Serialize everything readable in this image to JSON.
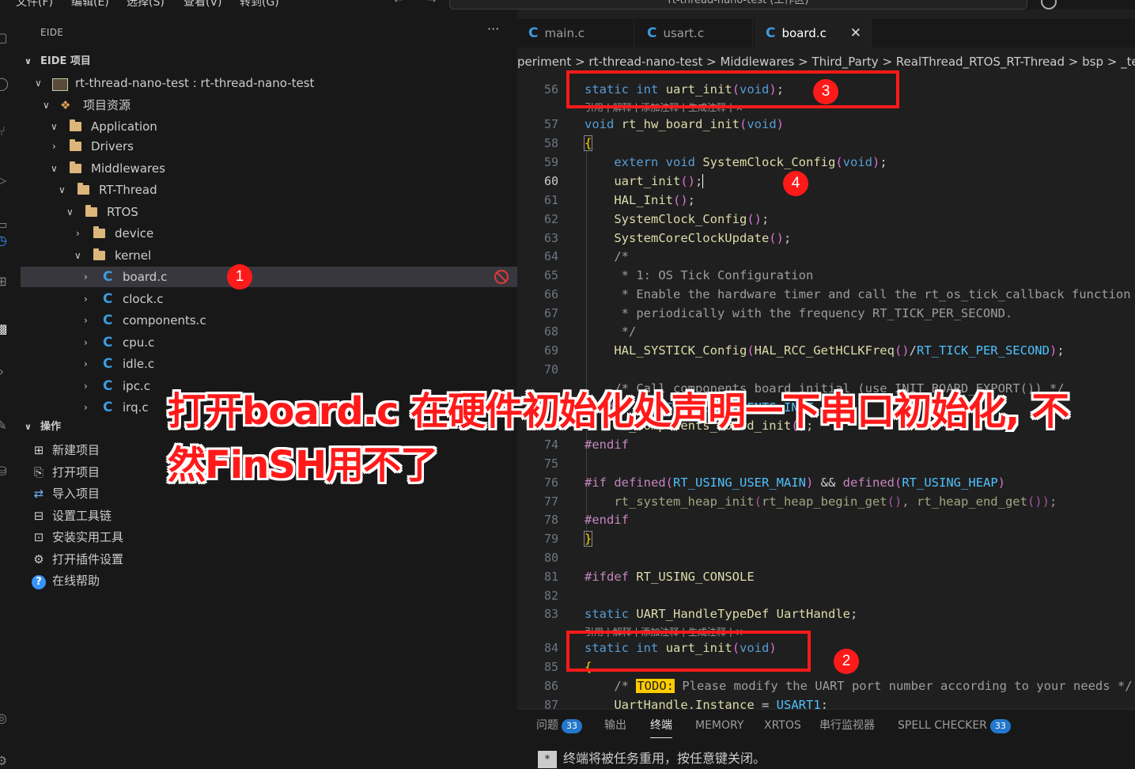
{
  "menu": [
    "文件(F)",
    "编辑(E)",
    "选择(S)",
    "查看(V)",
    "转到(G)"
  ],
  "command_center": "rt-thread-nano-test (工作区)",
  "sidebar": {
    "title": "EIDE",
    "section_project": "EIDE 项目",
    "tree": [
      {
        "label": "rt-thread-nano-test : rt-thread-nano-test"
      },
      {
        "label": "项目资源"
      },
      {
        "label": "Application"
      },
      {
        "label": "Drivers"
      },
      {
        "label": "Middlewares"
      },
      {
        "label": "RT-Thread"
      },
      {
        "label": "RTOS"
      },
      {
        "label": "device"
      },
      {
        "label": "kernel"
      },
      {
        "label": "board.c"
      },
      {
        "label": "clock.c"
      },
      {
        "label": "components.c"
      },
      {
        "label": "cpu.c"
      },
      {
        "label": "idle.c"
      },
      {
        "label": "ipc.c"
      },
      {
        "label": "irq.c"
      }
    ],
    "section_ops": "操作",
    "ops": [
      "新建项目",
      "打开项目",
      "导入项目",
      "设置工具链",
      "安装实用工具",
      "打开插件设置",
      "在线帮助"
    ]
  },
  "editor": {
    "tabs": [
      {
        "label": "main.c",
        "icon": "C"
      },
      {
        "label": "usart.c",
        "icon": "C"
      },
      {
        "label": "board.c",
        "icon": "C",
        "close": "✕"
      }
    ],
    "breadcrumb": "periment > rt-thread-nano-test > Middlewares > Third_Party > RealThread_RTOS_RT-Thread > bsp > _template",
    "codelens": "引用 | 解释 | 添加注释 | 生成注释 | ×",
    "lines": [
      {
        "n": "56"
      },
      {
        "n": "57"
      },
      {
        "n": "58"
      },
      {
        "n": "59"
      },
      {
        "n": "60"
      },
      {
        "n": "61"
      },
      {
        "n": "62"
      },
      {
        "n": "63"
      },
      {
        "n": "64"
      },
      {
        "n": "65"
      },
      {
        "n": "66"
      },
      {
        "n": "67"
      },
      {
        "n": "68"
      },
      {
        "n": "69"
      },
      {
        "n": "70"
      },
      {
        "n": "73"
      },
      {
        "n": "74"
      },
      {
        "n": "75"
      },
      {
        "n": "76"
      },
      {
        "n": "77"
      },
      {
        "n": "78"
      },
      {
        "n": "79"
      },
      {
        "n": "80"
      },
      {
        "n": "81"
      },
      {
        "n": "82"
      },
      {
        "n": "83"
      },
      {
        "n": "84"
      },
      {
        "n": "85"
      },
      {
        "n": "86"
      },
      {
        "n": "87"
      }
    ]
  },
  "panel": {
    "tabs": [
      {
        "label": "问题",
        "badge": "33"
      },
      {
        "label": "输出"
      },
      {
        "label": "终端"
      },
      {
        "label": "MEMORY"
      },
      {
        "label": "XRTOS"
      },
      {
        "label": "串行监视器"
      },
      {
        "label": "SPELL CHECKER",
        "badge": "33"
      }
    ],
    "terminal_text": "终端将被任务重用，按任意键关闭。"
  },
  "annotations": {
    "n1": "1",
    "n2": "2",
    "n3": "3",
    "n4": "4",
    "note_line1": "打开board.c 在硬件初始化处声明一下串口初始化, 不",
    "note_line2": "然FinSH用不了"
  },
  "colors": {
    "accent": "#3c9ce0",
    "annotation_red": "#ff1a1a",
    "todo_bg": "#ffcc00"
  }
}
